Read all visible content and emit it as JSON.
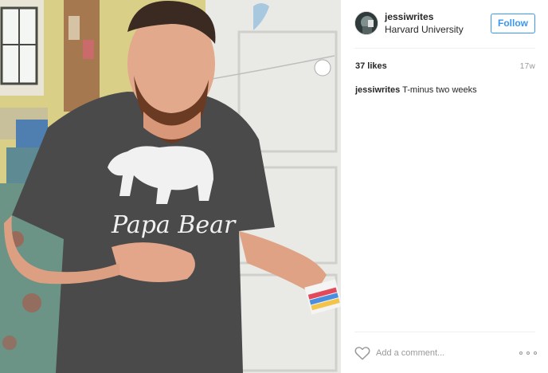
{
  "post": {
    "image_alt": "Man wearing a Papa Bear t-shirt holding his belly",
    "shirt_text": "Papa Bear"
  },
  "header": {
    "username": "jessiwrites",
    "location": "Harvard University",
    "follow_label": "Follow"
  },
  "stats": {
    "likes": "37 likes",
    "time_ago": "17w"
  },
  "caption": {
    "username": "jessiwrites",
    "text": "T-minus two weeks"
  },
  "comment_box": {
    "placeholder": "Add a comment..."
  },
  "icons": {
    "like": "heart-icon",
    "options": "more-options-icon"
  },
  "colors": {
    "accent": "#3897f0",
    "text": "#262626",
    "muted": "#999999",
    "divider": "#efefef"
  }
}
